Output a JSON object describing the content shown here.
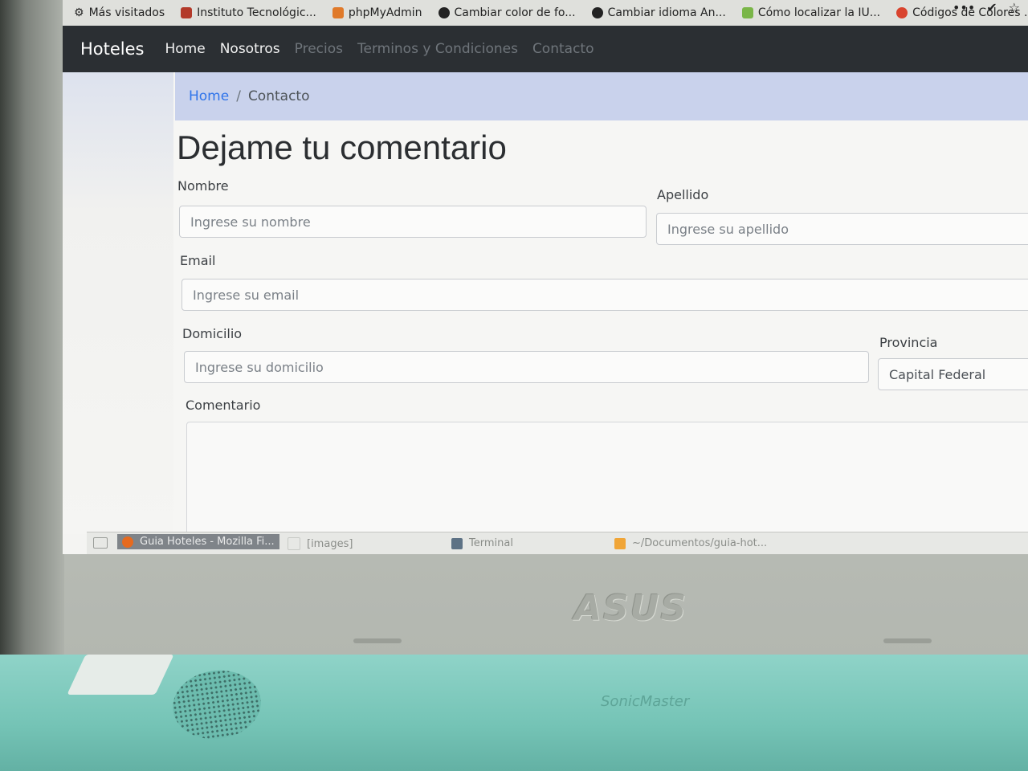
{
  "bookmarks": {
    "items": [
      {
        "label": "Más visitados",
        "icon": "gear-icon"
      },
      {
        "label": "Instituto Tecnológic...",
        "icon": "institute-icon"
      },
      {
        "label": "phpMyAdmin",
        "icon": "phpmyadmin-icon"
      },
      {
        "label": "Cambiar color de fo...",
        "icon": "github-icon"
      },
      {
        "label": "Cambiar idioma An...",
        "icon": "github-icon"
      },
      {
        "label": "Cómo localizar la IU...",
        "icon": "android-icon"
      },
      {
        "label": "Códigos de Colores .",
        "icon": "colors-icon"
      }
    ],
    "more": "•••",
    "pocket": "✔",
    "star": "☆"
  },
  "navbar": {
    "brand": "Hoteles",
    "links": [
      "Home",
      "Nosotros",
      "Precios",
      "Terminos y Condiciones",
      "Contacto"
    ]
  },
  "breadcrumb": {
    "home": "Home",
    "separator": "/",
    "current": "Contacto"
  },
  "form": {
    "title": "Dejame tu comentario",
    "nombre": {
      "label": "Nombre",
      "placeholder": "Ingrese su nombre"
    },
    "apellido": {
      "label": "Apellido",
      "placeholder": "Ingrese su apellido"
    },
    "email": {
      "label": "Email",
      "placeholder": "Ingrese su email"
    },
    "domicilio": {
      "label": "Domicilio",
      "placeholder": "Ingrese su domicilio"
    },
    "provincia": {
      "label": "Provincia",
      "value": "Capital Federal"
    },
    "comentario": {
      "label": "Comentario"
    }
  },
  "taskbar": {
    "items": [
      {
        "label": "Guia Hoteles - Mozilla Fi...",
        "icon": "firefox-icon"
      },
      {
        "label": "[images]",
        "icon": "folder-icon"
      },
      {
        "label": "Terminal",
        "icon": "terminal-icon"
      },
      {
        "label": "~/Documentos/guia-hot...",
        "icon": "editor-icon"
      }
    ]
  },
  "laptop": {
    "logo": "ASUS",
    "sonic": "SonicMaster"
  },
  "colors": {
    "navbar": "#2b2f33",
    "breadcrumb_bg": "#c9d2ec",
    "link": "#2f74ea",
    "base": "#75c4b6"
  }
}
